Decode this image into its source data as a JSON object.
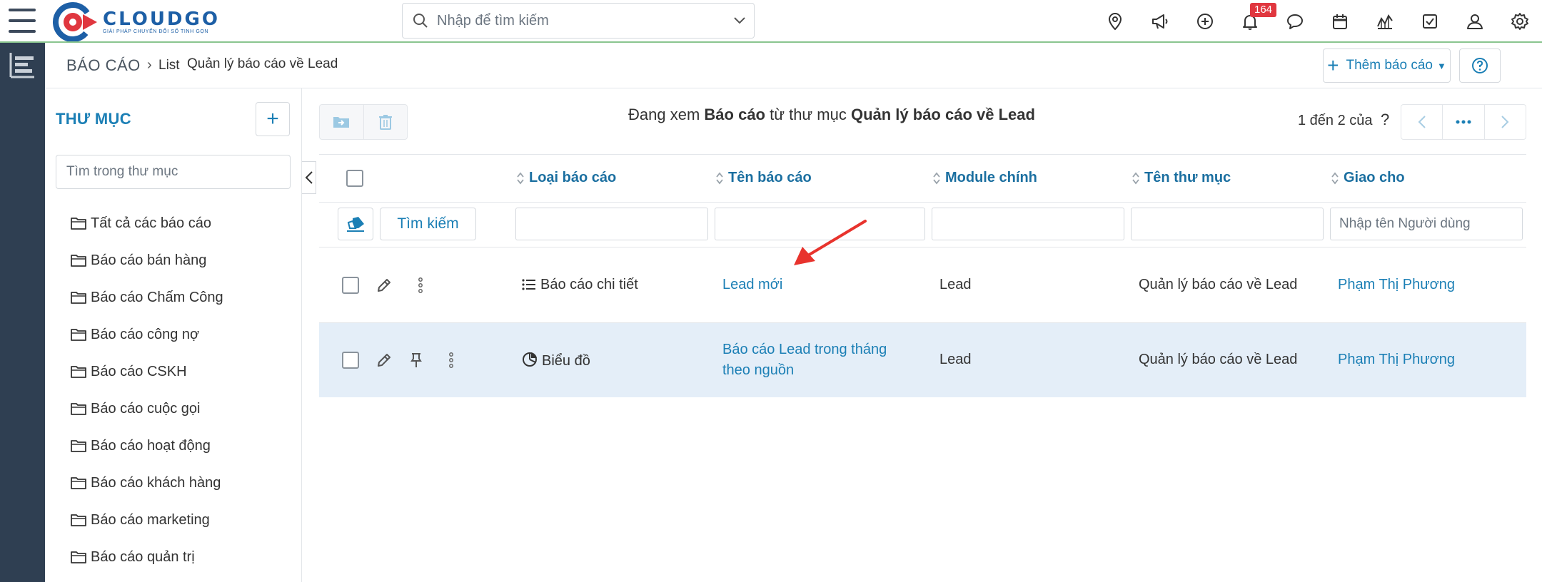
{
  "brand": {
    "name": "CLOUDGO",
    "tagline": "GIẢI PHÁP CHUYỂN ĐỔI SỐ TINH GỌN",
    "accent": "#1b7fb5",
    "logo_red": "#e0373f"
  },
  "search": {
    "placeholder": "Nhập để tìm kiếm"
  },
  "top_icons": [
    "map-pin-icon",
    "megaphone-icon",
    "plus-circle-icon",
    "bell-icon",
    "chat-icon",
    "calendar-icon",
    "chart-icon",
    "task-check-icon",
    "user-icon",
    "gear-icon"
  ],
  "notifications": {
    "count": "164"
  },
  "breadcrumb": {
    "root": "BÁO CÁO",
    "separator": "›",
    "list": "List",
    "current": "Quản lý báo cáo về Lead"
  },
  "header_actions": {
    "add_report": "Thêm báo cáo"
  },
  "folders": {
    "title": "THƯ MỤC",
    "search_placeholder": "Tìm trong thư mục",
    "items": [
      "Tất cả các báo cáo",
      "Báo cáo bán hàng",
      "Báo cáo Chấm Công",
      "Báo cáo công nợ",
      "Báo cáo CSKH",
      "Báo cáo cuộc gọi",
      "Báo cáo hoạt động",
      "Báo cáo khách hàng",
      "Báo cáo marketing",
      "Báo cáo quản trị"
    ]
  },
  "viewing": {
    "prefix": "Đang xem",
    "what": "Báo cáo",
    "middle": "từ thư mục",
    "folder": "Quản lý báo cáo về Lead"
  },
  "pagination": {
    "text": "1 đến 2 của",
    "unknown": "?"
  },
  "table": {
    "columns": [
      "Loại báo cáo",
      "Tên báo cáo",
      "Module chính",
      "Tên thư mục",
      "Giao cho"
    ],
    "filters": {
      "clear_icon": "eraser-icon",
      "search_label": "Tìm kiếm",
      "assignee_placeholder": "Nhập tên Người dùng"
    },
    "rows": [
      {
        "type": "Báo cáo chi tiết",
        "type_icon": "list-icon",
        "name": "Lead mới",
        "module": "Lead",
        "folder": "Quản lý báo cáo về Lead",
        "assignee": "Phạm Thị Phương",
        "pinned": false
      },
      {
        "type": "Biểu đồ",
        "type_icon": "pie-chart-icon",
        "name": "Báo cáo Lead trong tháng theo nguồn",
        "module": "Lead",
        "folder": "Quản lý báo cáo về Lead",
        "assignee": "Phạm Thị Phương",
        "pinned": true
      }
    ]
  },
  "annotation": {
    "arrow_color": "#e8332d"
  }
}
